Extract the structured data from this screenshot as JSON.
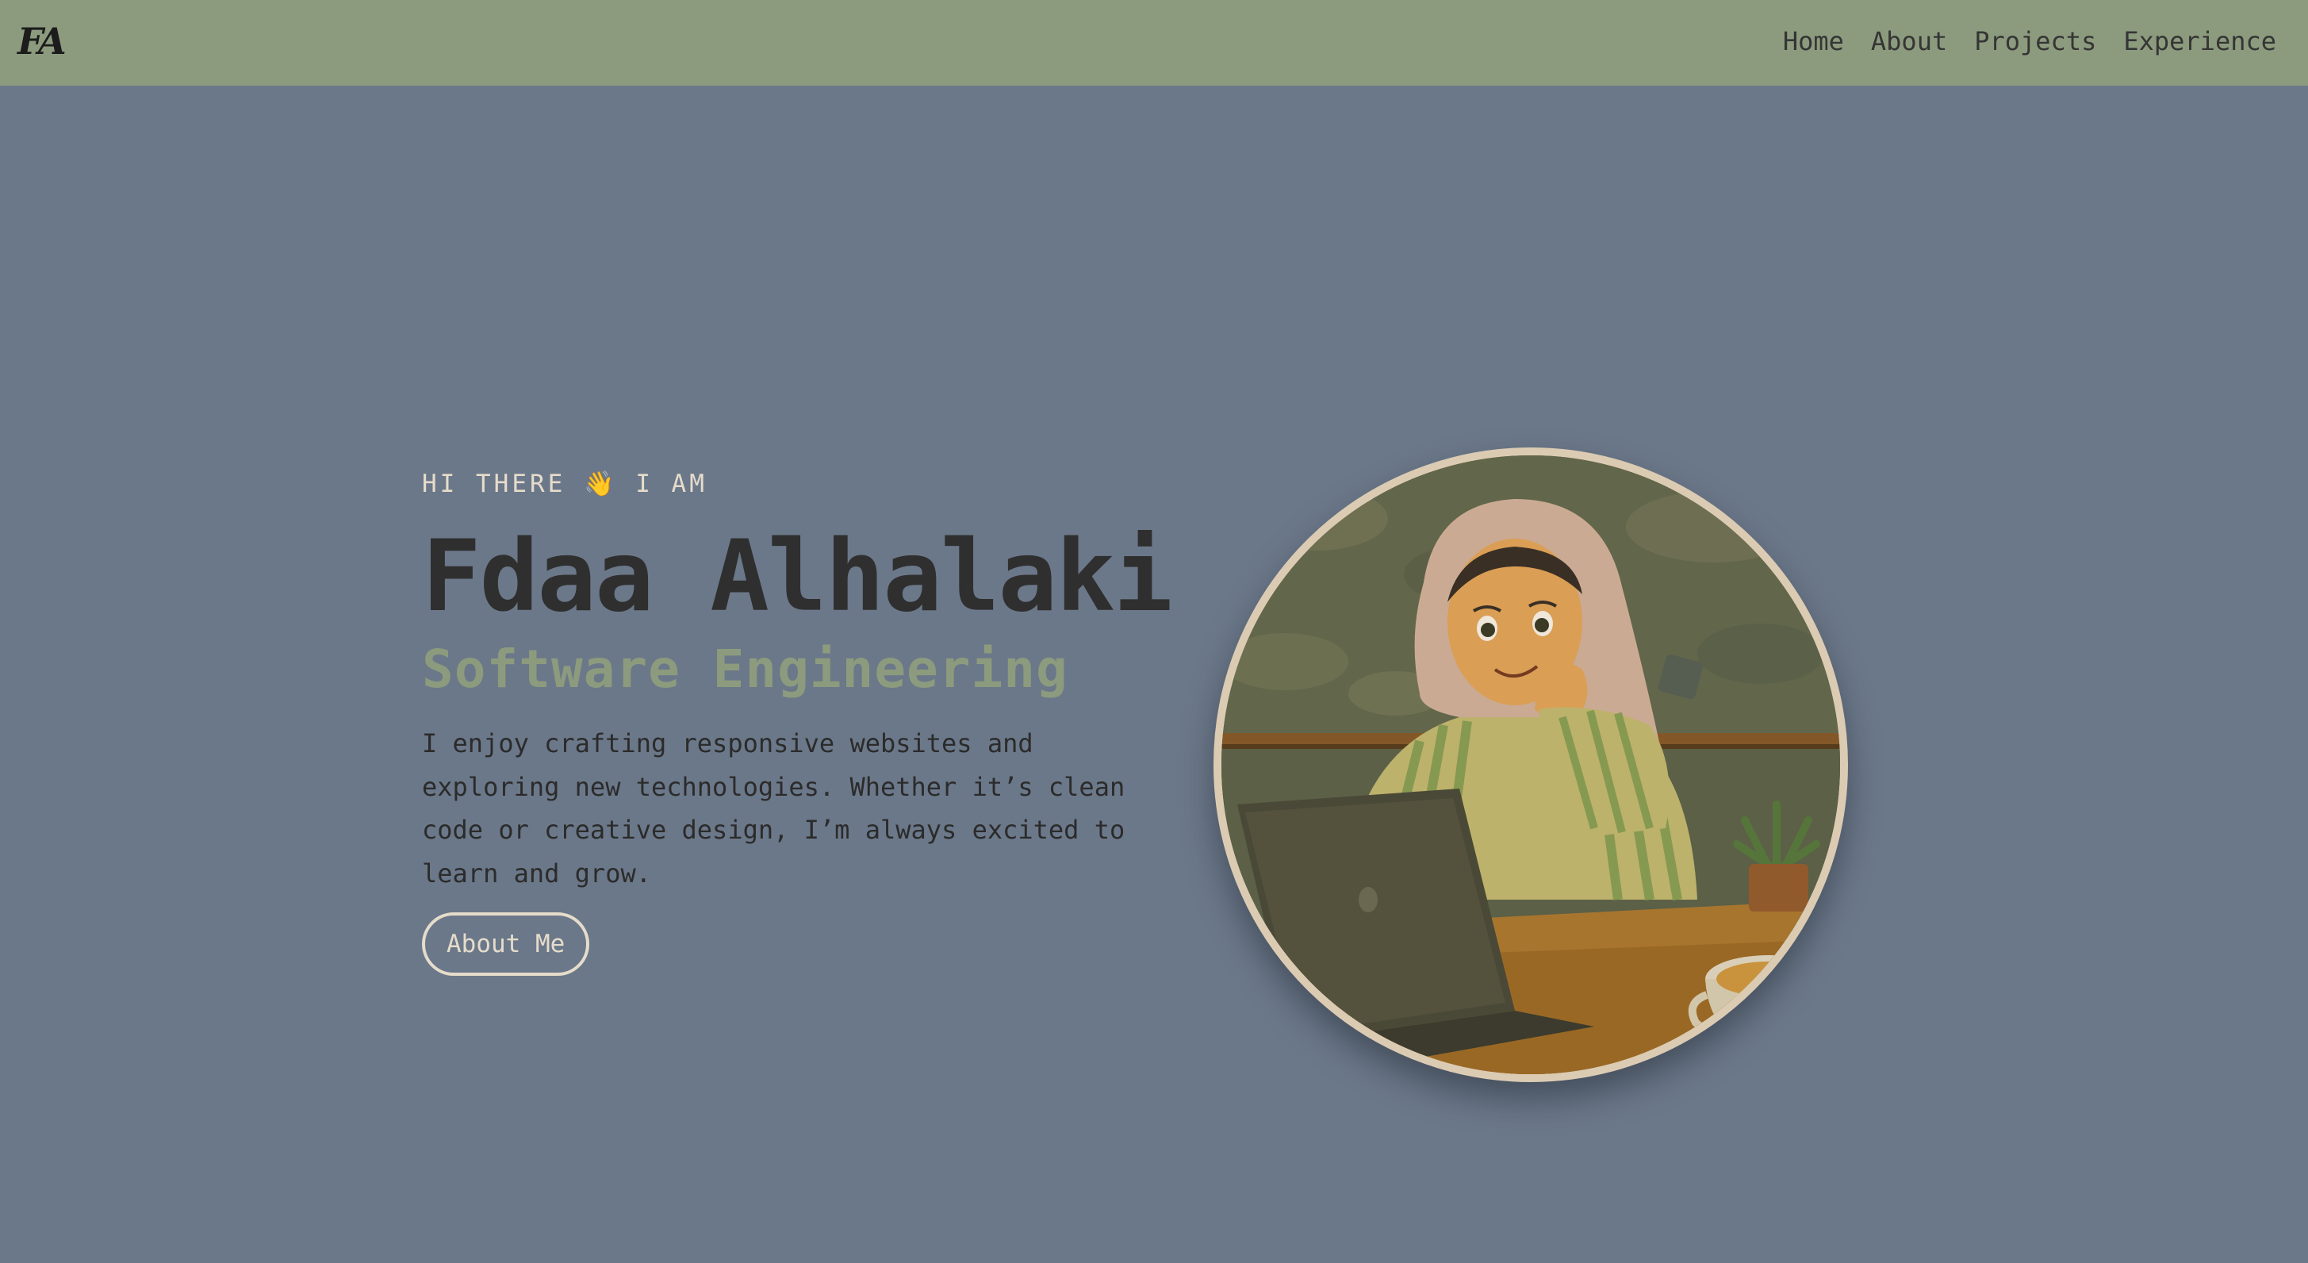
{
  "header": {
    "logo": "FA",
    "nav": [
      {
        "label": "Home"
      },
      {
        "label": "About"
      },
      {
        "label": "Projects"
      },
      {
        "label": "Experience"
      }
    ]
  },
  "hero": {
    "greeting": "HI THERE 👋 I AM",
    "name": "Fdaa Alhalaki",
    "role": "Software Engineering",
    "bio": "I enjoy crafting responsive websites and exploring new technologies. Whether it’s clean code or creative design, I’m always excited to learn and grow.",
    "cta_label": "About Me"
  },
  "colors": {
    "page_background": "#6b7889",
    "navbar_background": "#8c9b7d",
    "accent_sage": "#8c9b7d",
    "cream": "#e6dccb",
    "text_dark": "#2f2f2f"
  }
}
